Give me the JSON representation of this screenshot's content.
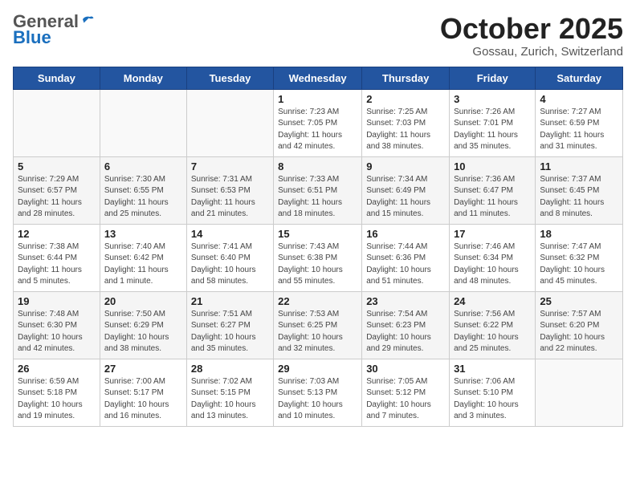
{
  "header": {
    "logo_general": "General",
    "logo_blue": "Blue",
    "month_title": "October 2025",
    "location": "Gossau, Zurich, Switzerland"
  },
  "weekdays": [
    "Sunday",
    "Monday",
    "Tuesday",
    "Wednesday",
    "Thursday",
    "Friday",
    "Saturday"
  ],
  "weeks": [
    [
      {
        "day": "",
        "info": ""
      },
      {
        "day": "",
        "info": ""
      },
      {
        "day": "",
        "info": ""
      },
      {
        "day": "1",
        "info": "Sunrise: 7:23 AM\nSunset: 7:05 PM\nDaylight: 11 hours\nand 42 minutes."
      },
      {
        "day": "2",
        "info": "Sunrise: 7:25 AM\nSunset: 7:03 PM\nDaylight: 11 hours\nand 38 minutes."
      },
      {
        "day": "3",
        "info": "Sunrise: 7:26 AM\nSunset: 7:01 PM\nDaylight: 11 hours\nand 35 minutes."
      },
      {
        "day": "4",
        "info": "Sunrise: 7:27 AM\nSunset: 6:59 PM\nDaylight: 11 hours\nand 31 minutes."
      }
    ],
    [
      {
        "day": "5",
        "info": "Sunrise: 7:29 AM\nSunset: 6:57 PM\nDaylight: 11 hours\nand 28 minutes."
      },
      {
        "day": "6",
        "info": "Sunrise: 7:30 AM\nSunset: 6:55 PM\nDaylight: 11 hours\nand 25 minutes."
      },
      {
        "day": "7",
        "info": "Sunrise: 7:31 AM\nSunset: 6:53 PM\nDaylight: 11 hours\nand 21 minutes."
      },
      {
        "day": "8",
        "info": "Sunrise: 7:33 AM\nSunset: 6:51 PM\nDaylight: 11 hours\nand 18 minutes."
      },
      {
        "day": "9",
        "info": "Sunrise: 7:34 AM\nSunset: 6:49 PM\nDaylight: 11 hours\nand 15 minutes."
      },
      {
        "day": "10",
        "info": "Sunrise: 7:36 AM\nSunset: 6:47 PM\nDaylight: 11 hours\nand 11 minutes."
      },
      {
        "day": "11",
        "info": "Sunrise: 7:37 AM\nSunset: 6:45 PM\nDaylight: 11 hours\nand 8 minutes."
      }
    ],
    [
      {
        "day": "12",
        "info": "Sunrise: 7:38 AM\nSunset: 6:44 PM\nDaylight: 11 hours\nand 5 minutes."
      },
      {
        "day": "13",
        "info": "Sunrise: 7:40 AM\nSunset: 6:42 PM\nDaylight: 11 hours\nand 1 minute."
      },
      {
        "day": "14",
        "info": "Sunrise: 7:41 AM\nSunset: 6:40 PM\nDaylight: 10 hours\nand 58 minutes."
      },
      {
        "day": "15",
        "info": "Sunrise: 7:43 AM\nSunset: 6:38 PM\nDaylight: 10 hours\nand 55 minutes."
      },
      {
        "day": "16",
        "info": "Sunrise: 7:44 AM\nSunset: 6:36 PM\nDaylight: 10 hours\nand 51 minutes."
      },
      {
        "day": "17",
        "info": "Sunrise: 7:46 AM\nSunset: 6:34 PM\nDaylight: 10 hours\nand 48 minutes."
      },
      {
        "day": "18",
        "info": "Sunrise: 7:47 AM\nSunset: 6:32 PM\nDaylight: 10 hours\nand 45 minutes."
      }
    ],
    [
      {
        "day": "19",
        "info": "Sunrise: 7:48 AM\nSunset: 6:30 PM\nDaylight: 10 hours\nand 42 minutes."
      },
      {
        "day": "20",
        "info": "Sunrise: 7:50 AM\nSunset: 6:29 PM\nDaylight: 10 hours\nand 38 minutes."
      },
      {
        "day": "21",
        "info": "Sunrise: 7:51 AM\nSunset: 6:27 PM\nDaylight: 10 hours\nand 35 minutes."
      },
      {
        "day": "22",
        "info": "Sunrise: 7:53 AM\nSunset: 6:25 PM\nDaylight: 10 hours\nand 32 minutes."
      },
      {
        "day": "23",
        "info": "Sunrise: 7:54 AM\nSunset: 6:23 PM\nDaylight: 10 hours\nand 29 minutes."
      },
      {
        "day": "24",
        "info": "Sunrise: 7:56 AM\nSunset: 6:22 PM\nDaylight: 10 hours\nand 25 minutes."
      },
      {
        "day": "25",
        "info": "Sunrise: 7:57 AM\nSunset: 6:20 PM\nDaylight: 10 hours\nand 22 minutes."
      }
    ],
    [
      {
        "day": "26",
        "info": "Sunrise: 6:59 AM\nSunset: 5:18 PM\nDaylight: 10 hours\nand 19 minutes."
      },
      {
        "day": "27",
        "info": "Sunrise: 7:00 AM\nSunset: 5:17 PM\nDaylight: 10 hours\nand 16 minutes."
      },
      {
        "day": "28",
        "info": "Sunrise: 7:02 AM\nSunset: 5:15 PM\nDaylight: 10 hours\nand 13 minutes."
      },
      {
        "day": "29",
        "info": "Sunrise: 7:03 AM\nSunset: 5:13 PM\nDaylight: 10 hours\nand 10 minutes."
      },
      {
        "day": "30",
        "info": "Sunrise: 7:05 AM\nSunset: 5:12 PM\nDaylight: 10 hours\nand 7 minutes."
      },
      {
        "day": "31",
        "info": "Sunrise: 7:06 AM\nSunset: 5:10 PM\nDaylight: 10 hours\nand 3 minutes."
      },
      {
        "day": "",
        "info": ""
      }
    ]
  ]
}
